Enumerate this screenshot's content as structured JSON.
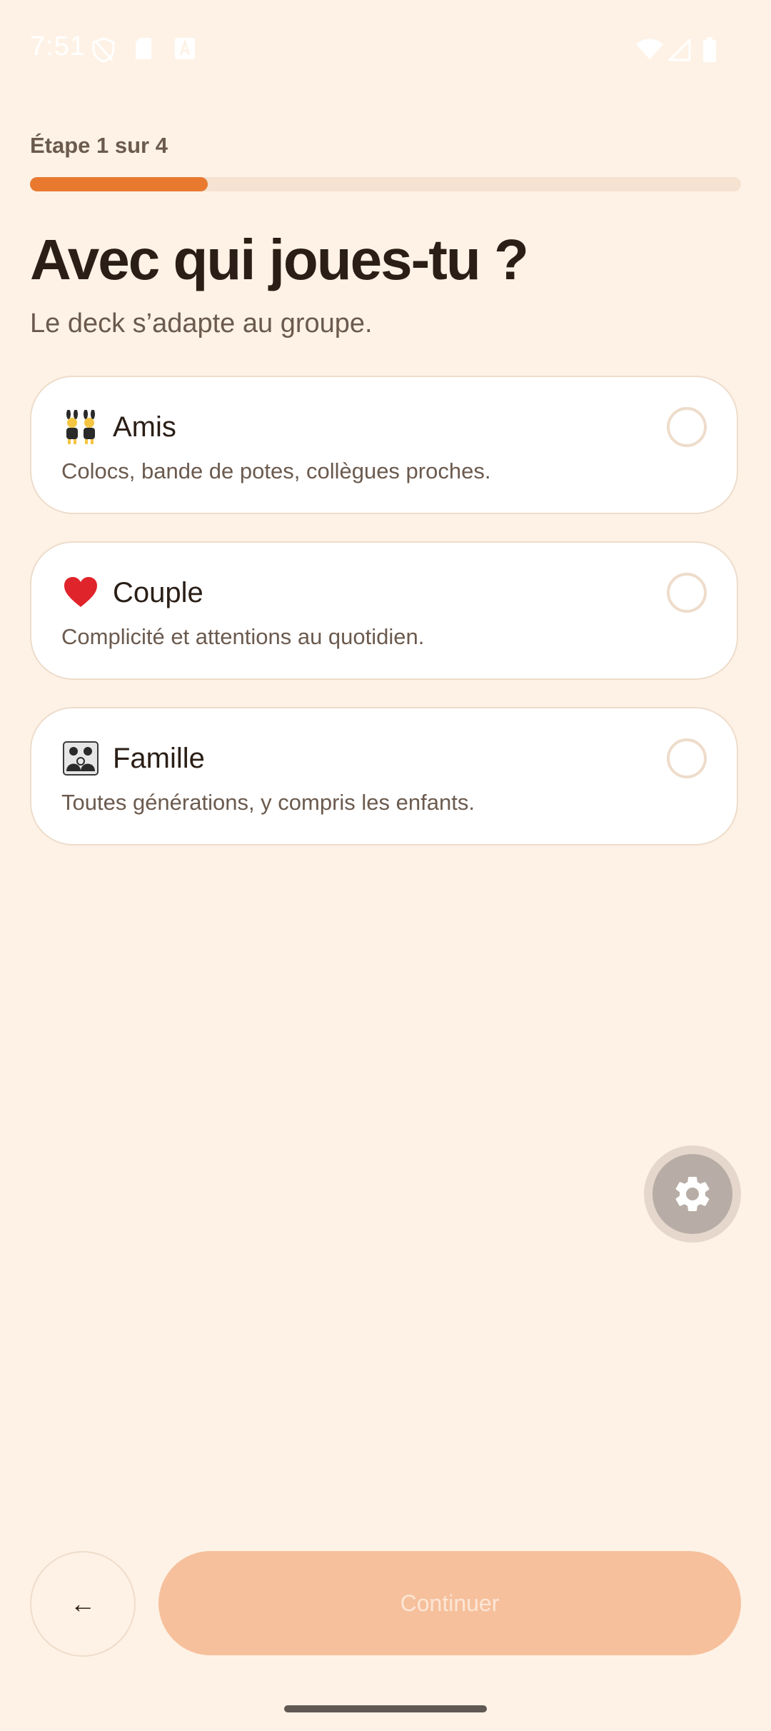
{
  "status_bar": {
    "time": "7:51"
  },
  "step": {
    "label": "Étape 1 sur 4",
    "current": 1,
    "total": 4,
    "progress": 0.25
  },
  "header": {
    "title": "Avec qui joues-tu ?",
    "subtitle": "Le deck s’adapte au groupe."
  },
  "options": [
    {
      "emoji": "people-with-bunny-ears-emoji",
      "title": "Amis",
      "description": "Colocs, bande de potes, collègues proches.",
      "selected": false
    },
    {
      "emoji": "red-heart-emoji",
      "title": "Couple",
      "description": "Complicité et attentions au quotidien.",
      "selected": false
    },
    {
      "emoji": "family-emoji",
      "title": "Famille",
      "description": "Toutes générations, y compris les enfants.",
      "selected": false
    }
  ],
  "fab": {
    "icon": "gear-icon"
  },
  "footer": {
    "back_label": "←",
    "continue_label": "Continuer",
    "continue_enabled": false
  },
  "colors": {
    "background": "#FEF2E6",
    "accent": "#E8792F",
    "continue_disabled": "#F6C09C"
  }
}
